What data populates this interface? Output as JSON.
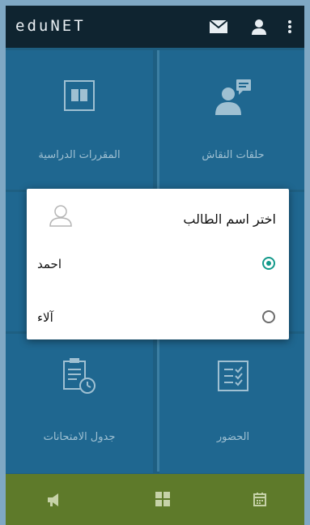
{
  "app": {
    "title": "eduNET"
  },
  "toolbar": {
    "icons": [
      "mail-icon",
      "user-icon",
      "more-vertical-icon"
    ]
  },
  "tiles": [
    {
      "label": "المقررات الدراسية",
      "icon": "book-icon"
    },
    {
      "label": "حلقات النقاش",
      "icon": "discussion-icon"
    },
    {
      "label": "جدول الامتحانات",
      "icon": "exam-schedule-icon"
    },
    {
      "label": "الحضور",
      "icon": "attendance-icon"
    }
  ],
  "bottom_nav": {
    "icons": [
      "announcement-icon",
      "grid-icon",
      "calendar-icon"
    ]
  },
  "dialog": {
    "title": "اختر اسم الطالب",
    "options": [
      {
        "label": "احمد",
        "selected": true
      },
      {
        "label": "آلاء",
        "selected": false
      }
    ]
  },
  "colors": {
    "appbar": "#0f2430",
    "tile": "#1f6790",
    "bottom_nav": "#5e7a2a",
    "radio_accent": "#12998a"
  }
}
